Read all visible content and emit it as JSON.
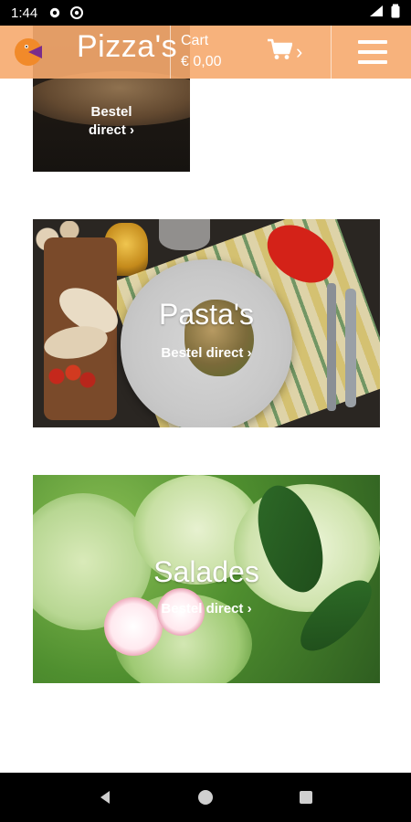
{
  "status_bar": {
    "time": "1:44"
  },
  "header": {
    "brand_title": "Pizza's",
    "cart_label": "Cart",
    "cart_total": "€ 0,00",
    "cart_chevron": "›",
    "colors": {
      "header_bg": "#F6AA6E",
      "logo_orange": "#F18A2A",
      "logo_purple": "#7A2C8B"
    }
  },
  "cards": {
    "pizzas": {
      "cta_line1": "Bestel",
      "cta_line2": "direct ›"
    },
    "pastas": {
      "title": "Pasta's",
      "cta": "Bestel direct ›"
    },
    "salades": {
      "title": "Salades",
      "cta": "Bestel direct ›"
    }
  },
  "icons": {
    "status": [
      "gear-icon",
      "data-saver-icon",
      "signal-icon",
      "battery-icon"
    ],
    "header": [
      "logo-icon",
      "cart-icon",
      "menu-icon"
    ],
    "navbar": [
      "back-icon",
      "home-icon",
      "recent-apps-icon"
    ]
  }
}
